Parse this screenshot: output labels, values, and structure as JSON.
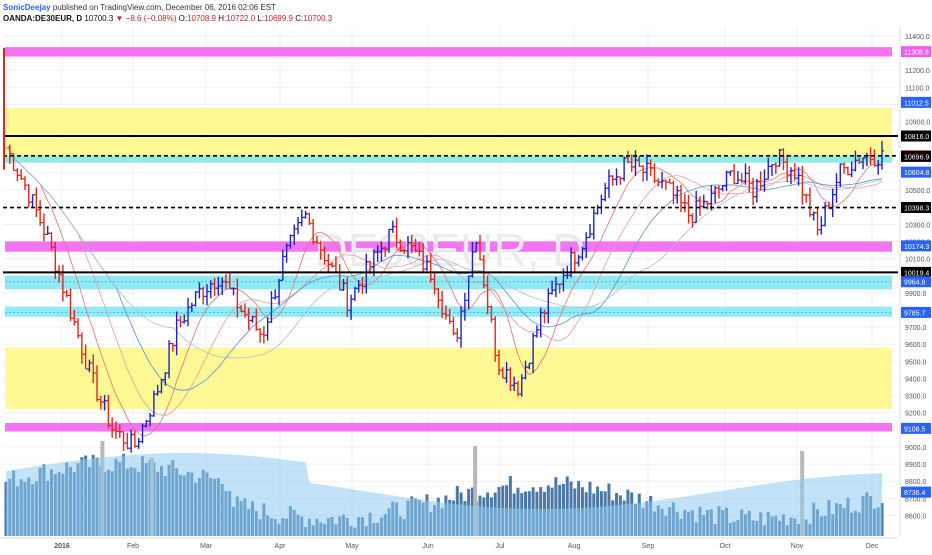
{
  "header": {
    "author": "SonicDeejay",
    "published": "published on TradingView.com, December 06, 2016 02:06 EST",
    "symbol": "OANDA:DE30EUR, D",
    "last": "10700.3",
    "change": "−8.6 (−0.08%)",
    "o_label": "O:",
    "o_value": "10708.9",
    "h_label": "H:",
    "h_value": "10722.0",
    "l_label": "L:",
    "l_value": "10699.9",
    "c_label": "C:",
    "c_value": "10700.3"
  },
  "watermark": "DE30EUR, D",
  "colors": {
    "up": "#1e22c8",
    "down": "#e52618",
    "yellow_zone": "#fff88a",
    "magenta_zone": "#f25cf2",
    "cyan_zone": "#7fe8f2",
    "volume": "#4a78a8",
    "volume_ma": "#8fcaf0"
  },
  "chart_data": {
    "type": "candlestick-ohlc",
    "x_ticks": [
      "2016",
      "Feb",
      "Mar",
      "Apr",
      "May",
      "Jun",
      "Jul",
      "Aug",
      "Sep",
      "Oct",
      "Nov",
      "Dec"
    ],
    "y_ticks": [
      11400,
      11300,
      11200,
      11100,
      11000,
      10900,
      10800,
      10700,
      10600,
      10500,
      10400,
      10300,
      10200,
      10100,
      10000,
      9900,
      9800,
      9700,
      9600,
      9500,
      9400,
      9300,
      9200,
      9100,
      9000,
      8900,
      8800,
      8700,
      8600
    ],
    "y_tick_labels": [
      "11400.0",
      "11300.0",
      "11200.0",
      "11100.0",
      "11000.0",
      "10900.0",
      "10800.0",
      "10700.0",
      "10600.0",
      "10500.0",
      "10400.0",
      "10300.0",
      "10200.0",
      "10100.0",
      "10000.0",
      "9900.0",
      "9800.0",
      "9700.0",
      "9600.0",
      "9500.0",
      "9400.0",
      "9300.0",
      "9200.0",
      "9100.0",
      "9000.0",
      "8900.0",
      "8800.0",
      "8700.0",
      "8600.0"
    ],
    "price_labels": [
      {
        "value": 11308.8,
        "text": "11308.8",
        "bg": "#f25cf2"
      },
      {
        "value": 11012.5,
        "text": "11012.5",
        "bg": "#2962ff"
      },
      {
        "value": 10816.0,
        "text": "10816.0",
        "bg": "#000000"
      },
      {
        "value": 10700.3,
        "text": "10700.3",
        "bg": "#e52618"
      },
      {
        "value": 10696.9,
        "text": "10696.9",
        "bg": "#000000"
      },
      {
        "value": 10604.8,
        "text": "10604.8",
        "bg": "#2962ff"
      },
      {
        "value": 10398.3,
        "text": "10398.3",
        "bg": "#000000"
      },
      {
        "value": 10174.3,
        "text": "10174.3",
        "bg": "#2962ff"
      },
      {
        "value": 10019.4,
        "text": "10019.4",
        "bg": "#000000"
      },
      {
        "value": 9964.8,
        "text": "9964.8",
        "bg": "#2962ff"
      },
      {
        "value": 9785.7,
        "text": "9785.7",
        "bg": "#2962ff"
      },
      {
        "value": 9108.5,
        "text": "9108.5",
        "bg": "#2962ff"
      },
      {
        "value": 8736.4,
        "text": "8736.4",
        "bg": "#2962ff"
      }
    ],
    "zones": [
      {
        "kind": "magenta",
        "from": 11280,
        "to": 11335
      },
      {
        "kind": "yellow",
        "from": 10660,
        "to": 10980
      },
      {
        "kind": "cyan",
        "from": 10660,
        "to": 10700
      },
      {
        "kind": "magenta",
        "from": 10140,
        "to": 10200
      },
      {
        "kind": "cyan",
        "from": 9920,
        "to": 10000
      },
      {
        "kind": "cyan",
        "from": 9760,
        "to": 9820
      },
      {
        "kind": "yellow",
        "from": 9220,
        "to": 9580
      },
      {
        "kind": "magenta",
        "from": 9090,
        "to": 9140
      }
    ],
    "lines": [
      {
        "value": 10816.0,
        "style": "solid",
        "color": "#000000"
      },
      {
        "value": 10700.3,
        "style": "dashed",
        "color": "#000000"
      },
      {
        "value": 10398.3,
        "style": "dashed",
        "color": "#000000"
      },
      {
        "value": 10019.4,
        "style": "solid",
        "color": "#000000"
      }
    ],
    "price_path": [
      [
        "2016",
        10750
      ],
      [
        "2016",
        10500
      ],
      [
        "2016",
        10200
      ],
      [
        "2016",
        9800
      ],
      [
        "Feb",
        9400
      ],
      [
        "Feb",
        9100
      ],
      [
        "Feb",
        9000
      ],
      [
        "Feb",
        9300
      ],
      [
        "Mar",
        9700
      ],
      [
        "Mar",
        9900
      ],
      [
        "Mar",
        10000
      ],
      [
        "Apr",
        9800
      ],
      [
        "Apr",
        9650
      ],
      [
        "Apr",
        10100
      ],
      [
        "Apr",
        10350
      ],
      [
        "May",
        10100
      ],
      [
        "May",
        9850
      ],
      [
        "May",
        10050
      ],
      [
        "May",
        10250
      ],
      [
        "Jun",
        10150
      ],
      [
        "Jun",
        10000
      ],
      [
        "Jun",
        9600
      ],
      [
        "Jun",
        10250
      ],
      [
        "Jul",
        9500
      ],
      [
        "Jul",
        9350
      ],
      [
        "Jul",
        9750
      ],
      [
        "Jul",
        10000
      ],
      [
        "Aug",
        10200
      ],
      [
        "Aug",
        10500
      ],
      [
        "Aug",
        10650
      ],
      [
        "Sep",
        10600
      ],
      [
        "Sep",
        10500
      ],
      [
        "Sep",
        10350
      ],
      [
        "Sep",
        10450
      ],
      [
        "Oct",
        10600
      ],
      [
        "Oct",
        10500
      ],
      [
        "Oct",
        10700
      ],
      [
        "Nov",
        10600
      ],
      [
        "Nov",
        10250
      ],
      [
        "Nov",
        10600
      ],
      [
        "Nov",
        10700
      ],
      [
        "Dec",
        10700
      ]
    ]
  }
}
